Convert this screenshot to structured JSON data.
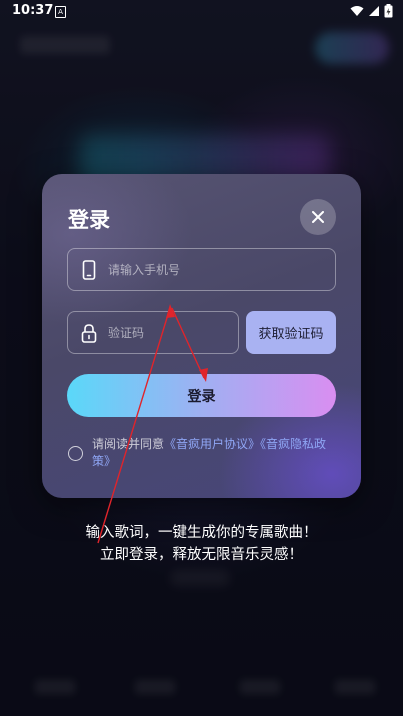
{
  "status_bar": {
    "time": "10:37",
    "indicator": "A",
    "icons": [
      "wifi-icon",
      "signal-icon",
      "battery-icon"
    ]
  },
  "dialog": {
    "title": "登录",
    "phone_placeholder": "请输入手机号",
    "code_placeholder": "验证码",
    "get_code_label": "获取验证码",
    "login_label": "登录",
    "agreement": {
      "prefix": "请阅读并同意",
      "user_agreement": "《音疯用户协议》",
      "privacy_policy": "《音疯隐私政策》"
    }
  },
  "tagline": {
    "line1": "输入歌词，一键生成你的专属歌曲！",
    "line2": "立即登录，释放无限音乐灵感！"
  },
  "colors": {
    "accent_cyan": "#5ad8f9",
    "accent_purple": "#d98ef1",
    "link": "#8fa6f5",
    "get_code_bg": "#a9b2f2",
    "annotation_arrow": "#e0242b"
  }
}
